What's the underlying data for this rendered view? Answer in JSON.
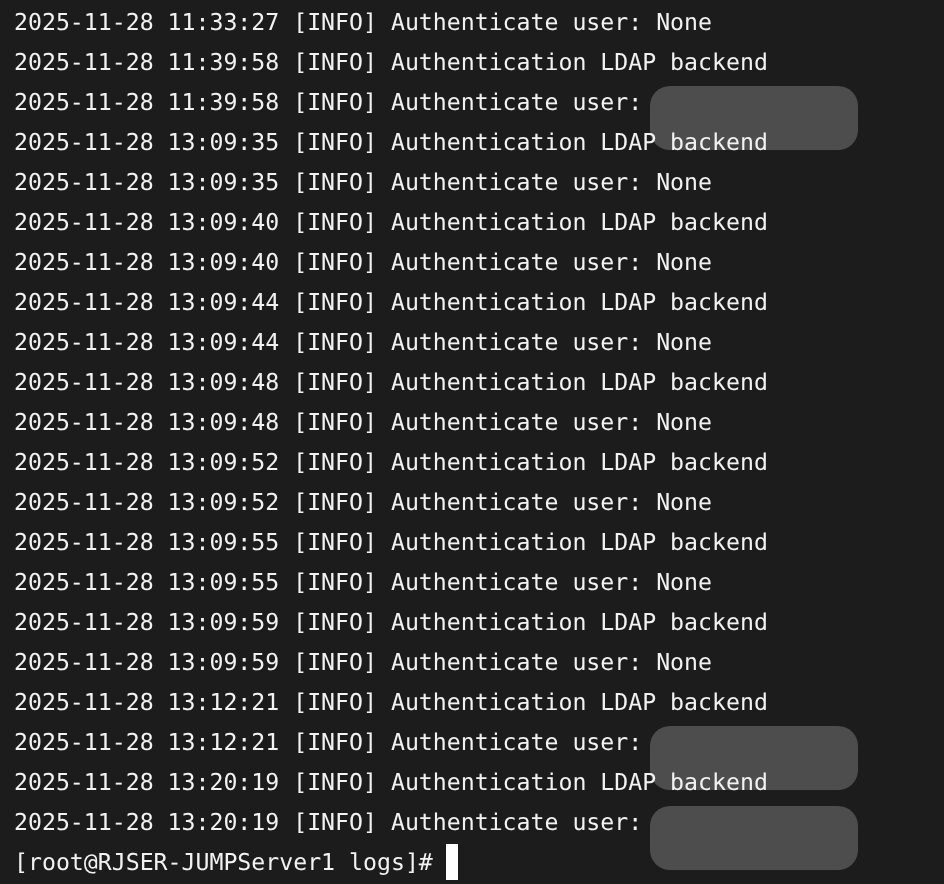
{
  "lines": [
    {
      "text": "2025-11-28 11:33:27 [INFO] Authenticate user: None",
      "redacted": false
    },
    {
      "text": "2025-11-28 11:39:58 [INFO] Authentication LDAP backend",
      "redacted": false
    },
    {
      "text": "2025-11-28 11:39:58 [INFO] Authenticate user:",
      "redacted": true
    },
    {
      "text": "2025-11-28 13:09:35 [INFO] Authentication LDAP backend",
      "redacted": false
    },
    {
      "text": "2025-11-28 13:09:35 [INFO] Authenticate user: None",
      "redacted": false
    },
    {
      "text": "2025-11-28 13:09:40 [INFO] Authentication LDAP backend",
      "redacted": false
    },
    {
      "text": "2025-11-28 13:09:40 [INFO] Authenticate user: None",
      "redacted": false
    },
    {
      "text": "2025-11-28 13:09:44 [INFO] Authentication LDAP backend",
      "redacted": false
    },
    {
      "text": "2025-11-28 13:09:44 [INFO] Authenticate user: None",
      "redacted": false
    },
    {
      "text": "2025-11-28 13:09:48 [INFO] Authentication LDAP backend",
      "redacted": false
    },
    {
      "text": "2025-11-28 13:09:48 [INFO] Authenticate user: None",
      "redacted": false
    },
    {
      "text": "2025-11-28 13:09:52 [INFO] Authentication LDAP backend",
      "redacted": false
    },
    {
      "text": "2025-11-28 13:09:52 [INFO] Authenticate user: None",
      "redacted": false
    },
    {
      "text": "2025-11-28 13:09:55 [INFO] Authentication LDAP backend",
      "redacted": false
    },
    {
      "text": "2025-11-28 13:09:55 [INFO] Authenticate user: None",
      "redacted": false
    },
    {
      "text": "2025-11-28 13:09:59 [INFO] Authentication LDAP backend",
      "redacted": false
    },
    {
      "text": "2025-11-28 13:09:59 [INFO] Authenticate user: None",
      "redacted": false
    },
    {
      "text": "2025-11-28 13:12:21 [INFO] Authentication LDAP backend",
      "redacted": false
    },
    {
      "text": "2025-11-28 13:12:21 [INFO] Authenticate user:",
      "redacted": true
    },
    {
      "text": "2025-11-28 13:20:19 [INFO] Authentication LDAP backend",
      "redacted": false
    },
    {
      "text": "2025-11-28 13:20:19 [INFO] Authenticate user:",
      "redacted": true
    }
  ],
  "prompt": {
    "text": "[root@RJSER-JUMPServer1 logs]#",
    "cursor": true
  }
}
